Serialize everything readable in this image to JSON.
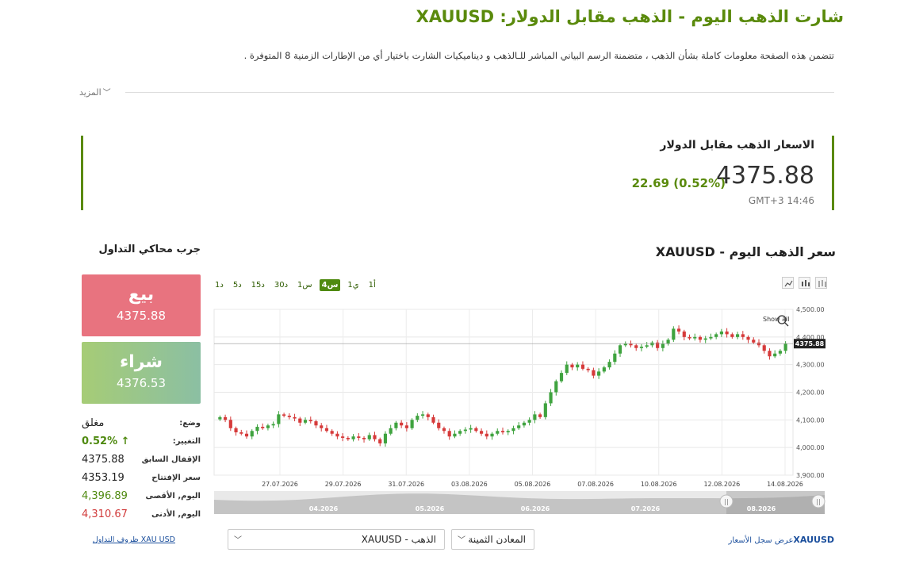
{
  "page": {
    "title": "شارت الذهب اليوم - الذهب مقابل الدولار: XAUUSD",
    "intro": "تتضمن هذه الصفحة معلومات كاملة بشأن الذهب ، متضمنة الرسم البياني المباشر للـالذهب و ديناميكيات الشارت باختيار أي من الإطارات الزمنية 8 المتوفرة .",
    "more_label": "المزيد"
  },
  "quote": {
    "title": "الاسعار الذهب مقابل الدولار",
    "price": "4375.88",
    "change": "22.69 (0.52%)",
    "time": "GMT+3 14:46"
  },
  "chart_section": {
    "title": "سعر الذهب اليوم - XAUUSD",
    "timeframes": [
      "1أ",
      "1ي",
      "4س",
      "1س",
      "30د",
      "15د",
      "5د",
      "1د"
    ],
    "active_timeframe": "4س",
    "tools": [
      "line-chart-icon",
      "candle-chart-icon",
      "bar-chart-icon"
    ],
    "show_all": "Show all",
    "price_tag": "4375.88"
  },
  "simulator": {
    "title": "جرب محاكي التداول",
    "sell_label": "بيع",
    "sell_price": "4375.88",
    "buy_label": "شراء",
    "buy_price": "4376.53"
  },
  "stats": [
    {
      "label": "وضع:",
      "value": "مغلق",
      "tone": "dark"
    },
    {
      "label": "التغيير:",
      "value": "0.52% ↑",
      "tone": "green-bold"
    },
    {
      "label": "الإقفال السابق",
      "value": "4375.88",
      "tone": "dark"
    },
    {
      "label": "سعر الإفتتاح",
      "value": "4353.19",
      "tone": "dark"
    },
    {
      "label": "اليوم, الأقصى",
      "value": "4,396.89",
      "tone": "green"
    },
    {
      "label": "اليوم, الأدنى",
      "value": "4,310.67",
      "tone": "red"
    }
  ],
  "conditions_link": "ظروف التداول XAU USD",
  "selects": {
    "instrument": "XAUUSD - الذهب",
    "category": "المعادن الثمينة"
  },
  "history_link": {
    "symbol": "XAUUSD",
    "text": "عرض سجل الأسعار"
  },
  "colors": {
    "accent": "#5a8a0c",
    "up": "#3fa33f",
    "down": "#d63a3a",
    "sell": "#e8737f",
    "buy_start": "#a6cc76",
    "buy_end": "#8bbfa3"
  },
  "chart_data": {
    "type": "candlestick",
    "y_ticks": [
      "4,500.00",
      "4,400.00",
      "4,300.00",
      "4,200.00",
      "4,100.00",
      "4,000.00",
      "3,900.00"
    ],
    "ylim": [
      3900,
      4500
    ],
    "x_ticks": [
      "27.07.2026",
      "29.07.2026",
      "31.07.2026",
      "03.08.2026",
      "05.08.2026",
      "07.08.2026",
      "10.08.2026",
      "12.08.2026",
      "14.08.2026"
    ],
    "navigator_labels": [
      "04.2026",
      "05.2026",
      "06.2026",
      "07.2026",
      "08.2026"
    ],
    "current_price": 4375.88,
    "close": [
      4110,
      4100,
      4070,
      4055,
      4050,
      4040,
      4060,
      4075,
      4070,
      4080,
      4085,
      4120,
      4115,
      4110,
      4105,
      4090,
      4100,
      4095,
      4080,
      4070,
      4060,
      4050,
      4040,
      4035,
      4030,
      4040,
      4035,
      4030,
      4045,
      4030,
      4015,
      4050,
      4070,
      4090,
      4080,
      4070,
      4100,
      4115,
      4120,
      4110,
      4090,
      4070,
      4060,
      4040,
      4050,
      4060,
      4065,
      4070,
      4060,
      4050,
      4040,
      4050,
      4060,
      4055,
      4060,
      4070,
      4080,
      4090,
      4100,
      4120,
      4110,
      4160,
      4200,
      4240,
      4270,
      4300,
      4290,
      4300,
      4285,
      4280,
      4260,
      4275,
      4290,
      4310,
      4340,
      4370,
      4375,
      4370,
      4360,
      4365,
      4370,
      4380,
      4360,
      4375,
      4390,
      4430,
      4420,
      4400,
      4395,
      4400,
      4390,
      4395,
      4400,
      4410,
      4420,
      4410,
      4400,
      4410,
      4400,
      4390,
      4380,
      4370,
      4350,
      4330,
      4340,
      4350,
      4375.88
    ]
  }
}
